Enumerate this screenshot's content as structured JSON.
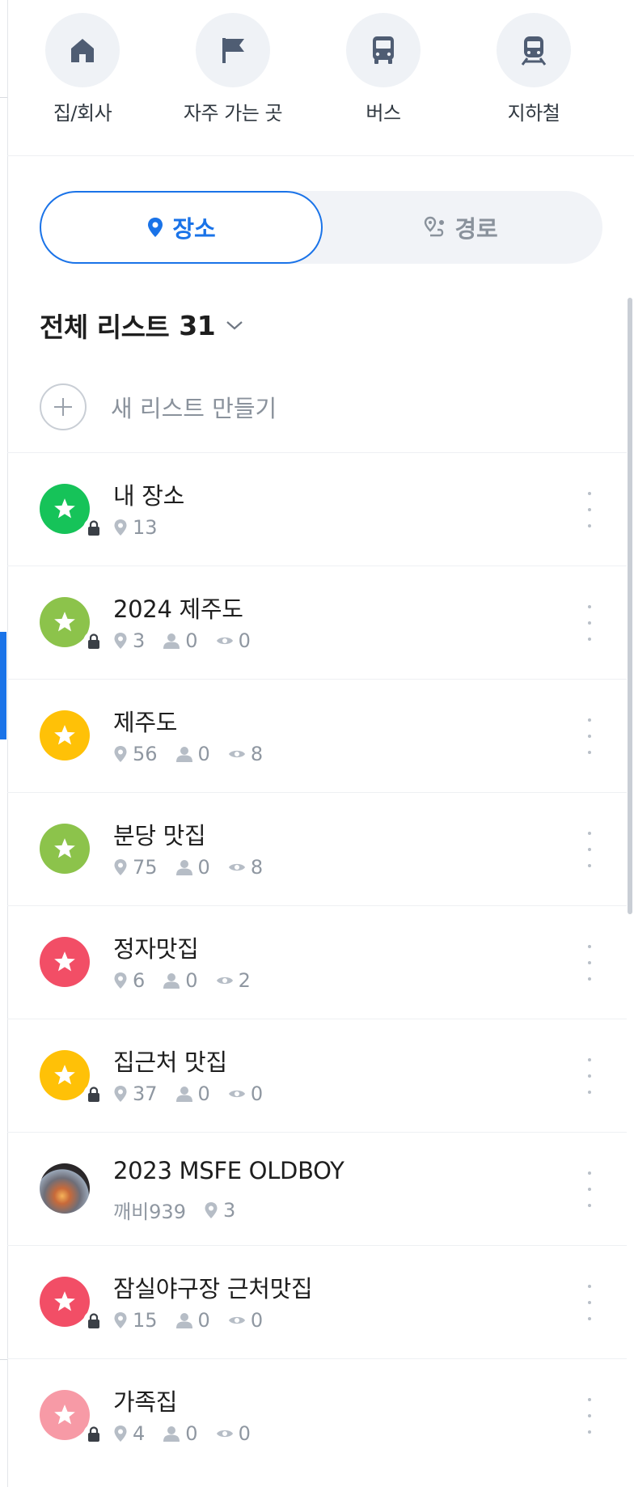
{
  "quick_menu": [
    {
      "label": "집/회사",
      "icon": "home-icon"
    },
    {
      "label": "자주 가는 곳",
      "icon": "flag-icon"
    },
    {
      "label": "버스",
      "icon": "bus-icon"
    },
    {
      "label": "지하철",
      "icon": "subway-icon"
    }
  ],
  "toggle": {
    "place": "장소",
    "route": "경로",
    "active": "place"
  },
  "list_header": {
    "title": "전체 리스트",
    "count": "31"
  },
  "new_list_label": "새 리스트 만들기",
  "lists": [
    {
      "title": "내 장소",
      "color": "#16c359",
      "locked": true,
      "places": "13"
    },
    {
      "title": "2024 제주도",
      "color": "#8cc34b",
      "locked": true,
      "places": "3",
      "followers": "0",
      "views": "0"
    },
    {
      "title": "제주도",
      "color": "#ffc107",
      "locked": false,
      "places": "56",
      "followers": "0",
      "views": "8"
    },
    {
      "title": "분당 맛집",
      "color": "#8cc34b",
      "locked": false,
      "places": "75",
      "followers": "0",
      "views": "8"
    },
    {
      "title": "정자맛집",
      "color": "#f24e66",
      "locked": false,
      "places": "6",
      "followers": "0",
      "views": "2"
    },
    {
      "title": "집근처 맛집",
      "color": "#ffc107",
      "locked": true,
      "places": "37",
      "followers": "0",
      "views": "0"
    },
    {
      "title": "2023 MSFE OLDBOY",
      "photo": true,
      "owner": "깨비939",
      "places": "3"
    },
    {
      "title": "잠실야구장 근처맛집",
      "color": "#f24e66",
      "locked": true,
      "places": "15",
      "followers": "0",
      "views": "0"
    },
    {
      "title": "가족집",
      "color": "#f79aa6",
      "locked": true,
      "places": "4",
      "followers": "0",
      "views": "0"
    }
  ]
}
